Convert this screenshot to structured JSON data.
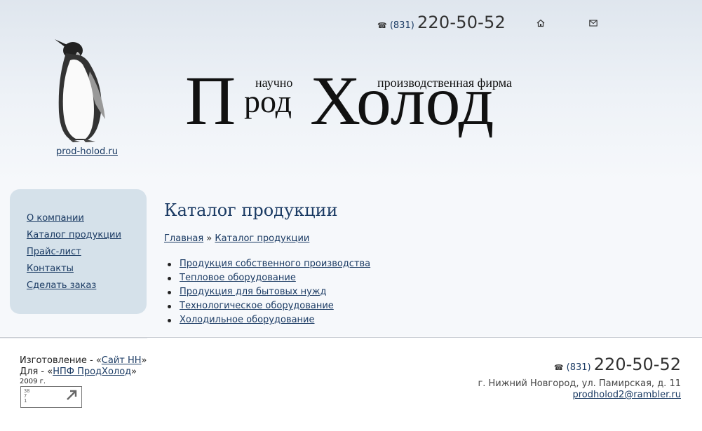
{
  "header": {
    "phone_code": "(831)",
    "phone_number": "220-50-52",
    "home_icon": "home-icon",
    "mail_icon": "mail-icon",
    "site_link": "prod-holod.ru",
    "logo": {
      "big_p": "П",
      "rod": "род",
      "holod": "Холод",
      "nauchno": "научно",
      "firma": "производственная фирма"
    }
  },
  "sidebar": {
    "items": [
      {
        "label": "О компании"
      },
      {
        "label": "Каталог продукции"
      },
      {
        "label": "Прайс-лист"
      },
      {
        "label": "Контакты"
      },
      {
        "label": "Сделать заказ"
      }
    ]
  },
  "main": {
    "title": "Каталог продукции",
    "breadcrumb": {
      "home": "Главная",
      "separator": "»",
      "current": "Каталог продукции"
    },
    "catalog": [
      {
        "label": "Продукция собственного производства"
      },
      {
        "label": "Тепловое оборудование"
      },
      {
        "label": "Продукция для бытовых нужд"
      },
      {
        "label": "Технологическое оборудование"
      },
      {
        "label": "Холодильное оборудование"
      }
    ]
  },
  "footer": {
    "made_prefix": "Изготовление - «",
    "made_link": "Сайт НН",
    "made_suffix": "»",
    "for_prefix": "Для - «",
    "for_link": "НПФ ПродХолод",
    "for_suffix": "»",
    "year": "2009 г.",
    "counter": {
      "line1": "38",
      "line2": "7",
      "line3": "1"
    },
    "phone_code": "(831)",
    "phone_number": "220-50-52",
    "address": "г. Нижний Новгород, ул. Памирская, д. 11",
    "email": "prodholod2@rambler.ru"
  },
  "colors": {
    "link": "#1a3a63",
    "sidebar_bg": "#d5e1ea"
  }
}
